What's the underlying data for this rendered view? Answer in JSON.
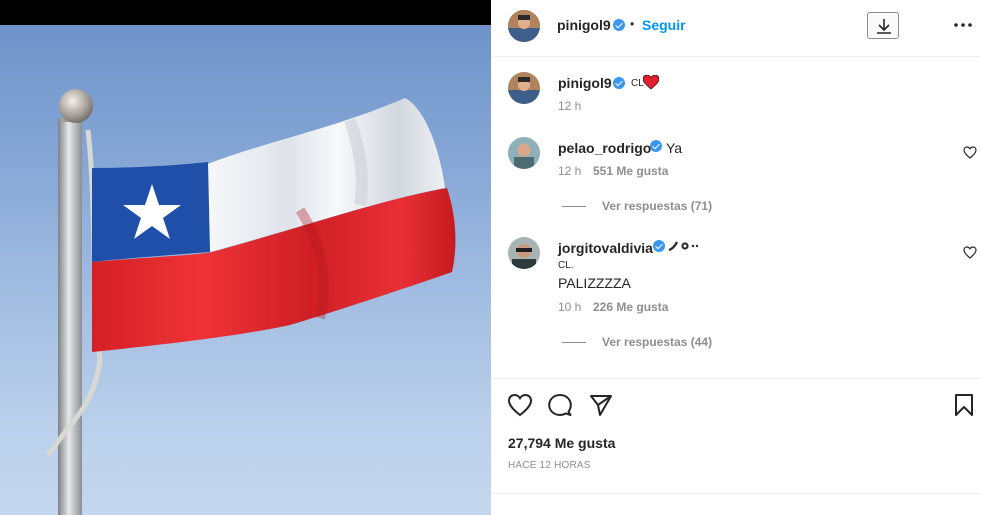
{
  "header": {
    "username": "pinigol9",
    "separator": "•",
    "follow_label": "Seguir"
  },
  "caption": {
    "username": "pinigol9",
    "text": "CL",
    "time": "12 h"
  },
  "comments": [
    {
      "username": "pelao_rodrigo",
      "text": "Ya",
      "time": "12 h",
      "likes": "551 Me gusta",
      "view_replies": "Ver respuestas (71)"
    },
    {
      "username": "jorgitovaldivia",
      "prefix": "CL.",
      "text": "PALIZZZZA",
      "time": "10 h",
      "likes": "226 Me gusta",
      "view_replies": "Ver respuestas (44)"
    }
  ],
  "footer": {
    "likes": "27,794 Me gusta",
    "date": "HACE 12 HORAS"
  },
  "icons": {
    "verified": "verified-badge-icon",
    "download": "download-icon",
    "more": "more-options-icon",
    "like": "heart-icon",
    "comment": "comment-icon",
    "share": "share-icon",
    "save": "bookmark-icon"
  },
  "colors": {
    "accent_blue": "#0095f6",
    "verified_blue": "#3897f0",
    "heart_red": "#ed4956",
    "flag_red": "#e32b2f",
    "flag_blue": "#1f4fa8",
    "text_primary": "#262626",
    "text_secondary": "#8e8e8e"
  }
}
